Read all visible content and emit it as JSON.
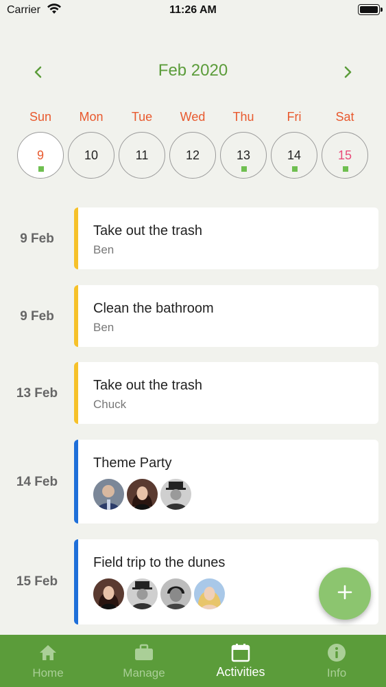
{
  "status_bar": {
    "carrier": "Carrier",
    "time": "11:26 AM"
  },
  "calendar": {
    "month_title": "Feb 2020",
    "weekdays": [
      "Sun",
      "Mon",
      "Tue",
      "Wed",
      "Thu",
      "Fri",
      "Sat"
    ],
    "days": [
      {
        "num": "9",
        "color": "red",
        "has_event": true,
        "selected": true
      },
      {
        "num": "10",
        "color": "default",
        "has_event": false,
        "selected": false
      },
      {
        "num": "11",
        "color": "default",
        "has_event": false,
        "selected": false
      },
      {
        "num": "12",
        "color": "default",
        "has_event": false,
        "selected": false
      },
      {
        "num": "13",
        "color": "default",
        "has_event": true,
        "selected": false
      },
      {
        "num": "14",
        "color": "default",
        "has_event": true,
        "selected": false
      },
      {
        "num": "15",
        "color": "pink",
        "has_event": true,
        "selected": false
      }
    ]
  },
  "events": [
    {
      "date": "9 Feb",
      "title": "Take out the trash",
      "subtitle": "Ben",
      "accent": "#f6c12a"
    },
    {
      "date": "9 Feb",
      "title": "Clean the bathroom",
      "subtitle": "Ben",
      "accent": "#f6c12a"
    },
    {
      "date": "13 Feb",
      "title": "Take out the trash",
      "subtitle": "Chuck",
      "accent": "#f6c12a"
    },
    {
      "date": "14 Feb",
      "title": "Theme Party",
      "participants": 3,
      "accent": "#1e6fd9"
    },
    {
      "date": "15 Feb",
      "title": "Field trip to the dunes",
      "participants": 4,
      "accent": "#1e6fd9"
    }
  ],
  "fab": {
    "icon": "plus-icon"
  },
  "tabs": [
    {
      "label": "Home",
      "icon": "home-icon",
      "active": false
    },
    {
      "label": "Manage",
      "icon": "briefcase-icon",
      "active": false
    },
    {
      "label": "Activities",
      "icon": "calendar-icon",
      "active": true
    },
    {
      "label": "Info",
      "icon": "info-icon",
      "active": false
    }
  ],
  "colors": {
    "brand_green": "#5b9c3a",
    "fab_green": "#8cc56f",
    "weekday_orange": "#e8592e",
    "chore_accent": "#f6c12a",
    "event_accent": "#1e6fd9",
    "background": "#f1f2ed"
  }
}
